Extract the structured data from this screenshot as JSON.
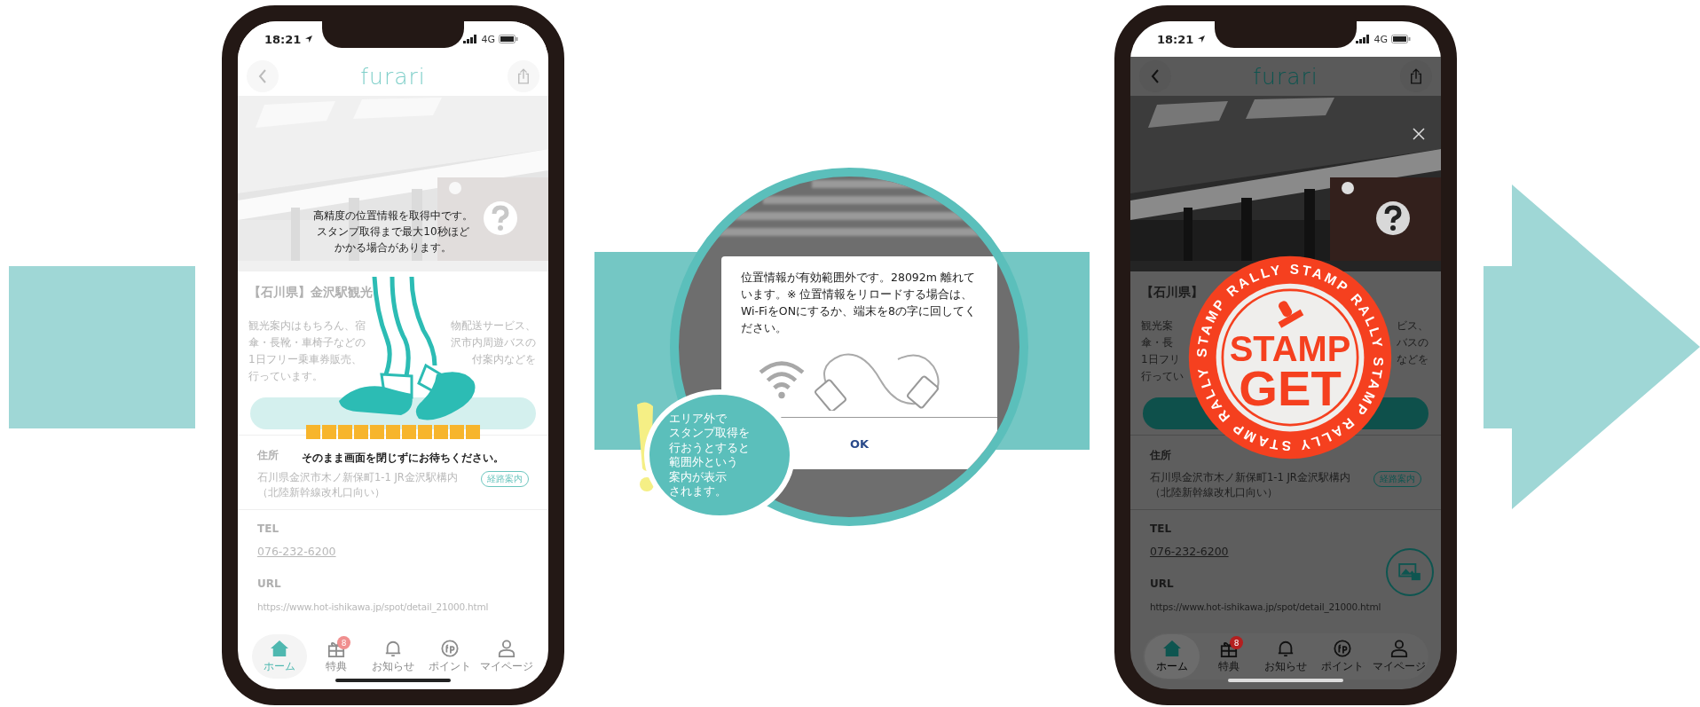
{
  "phones": [
    {
      "kind": "loading",
      "time": "18:21",
      "network": "4G",
      "logo": "furari",
      "loading_message": [
        "高精度の位置情報を取得中です。",
        "スタンプ取得まで最大10秒ほど",
        "かかる場合があります。"
      ],
      "title": "【石川県】金沢駅観光",
      "description": [
        {
          "left": "観光案内はもちろん、宿",
          "right": "物配送サービス、"
        },
        {
          "left": "傘・長靴・車椅子などの",
          "right": "沢市内周遊バスの"
        },
        {
          "left": "1日フリー乗車券販売、",
          "right": "付案内などを"
        },
        {
          "left": "行っています。"
        }
      ],
      "wait_message": "そのまま画面を閉じずにお待ちください。",
      "address_label": "住所",
      "address": "石川県金沢市木ノ新保町1-1 JR金沢駅構内（北陸新幹線改札口向い）",
      "route_badge": "経路案内",
      "tel_label": "TEL",
      "tel": "076-232-6200",
      "url_label": "URL",
      "url": "https://www.hot-ishikawa.jp/spot/detail_21000.html",
      "tabs": [
        {
          "kind": "home",
          "label": "ホーム",
          "selected": true
        },
        {
          "kind": "gift",
          "label": "特典",
          "selected": false,
          "badge": "8"
        },
        {
          "kind": "bell",
          "label": "お知らせ",
          "selected": false
        },
        {
          "kind": "points",
          "label": "ポイント",
          "selected": false
        },
        {
          "kind": "person",
          "label": "マイページ",
          "selected": false
        }
      ]
    },
    {
      "kind": "stamp",
      "time": "18:21",
      "network": "4G",
      "logo": "furari",
      "title": "【石川県】",
      "description": [
        {
          "left": "観光案",
          "right": "ビス、"
        },
        {
          "left": "傘・長",
          "right": "バスの"
        },
        {
          "left": "1日フリ",
          "right": "などを"
        },
        {
          "left": "行ってい"
        }
      ],
      "stamp": {
        "ring": "STAMP RALLY STAMP RALLY STAMP RALLY STAMP RALLY",
        "line_1": "STAMP",
        "line_2": "GET"
      },
      "address_label": "住所",
      "address": "石川県金沢市木ノ新保町1-1 JR金沢駅構内（北陸新幹線改札口向い）",
      "route_badge": "経路案内",
      "tel_label": "TEL",
      "tel": "076-232-6200",
      "url_label": "URL",
      "url": "https://www.hot-ishikawa.jp/spot/detail_21000.html",
      "tabs": [
        {
          "kind": "home",
          "label": "ホーム",
          "selected": true
        },
        {
          "kind": "gift",
          "label": "特典",
          "selected": false,
          "badge": "8"
        },
        {
          "kind": "bell",
          "label": "お知らせ",
          "selected": false
        },
        {
          "kind": "points",
          "label": "ポイント",
          "selected": false
        },
        {
          "kind": "person",
          "label": "マイページ",
          "selected": false
        }
      ]
    }
  ],
  "dialog": {
    "message": "位置情報が有効範囲外です。28092m 離れています。※ 位置情報をリロードする場合は、Wi-FiをONにするか、端末を8の字に回してください。",
    "ok": "OK"
  },
  "callout": {
    "lines": [
      "エリア外で",
      "スタンプ取得を",
      "行おうとすると",
      "範囲外という",
      "案内が表示",
      "されます。"
    ]
  }
}
